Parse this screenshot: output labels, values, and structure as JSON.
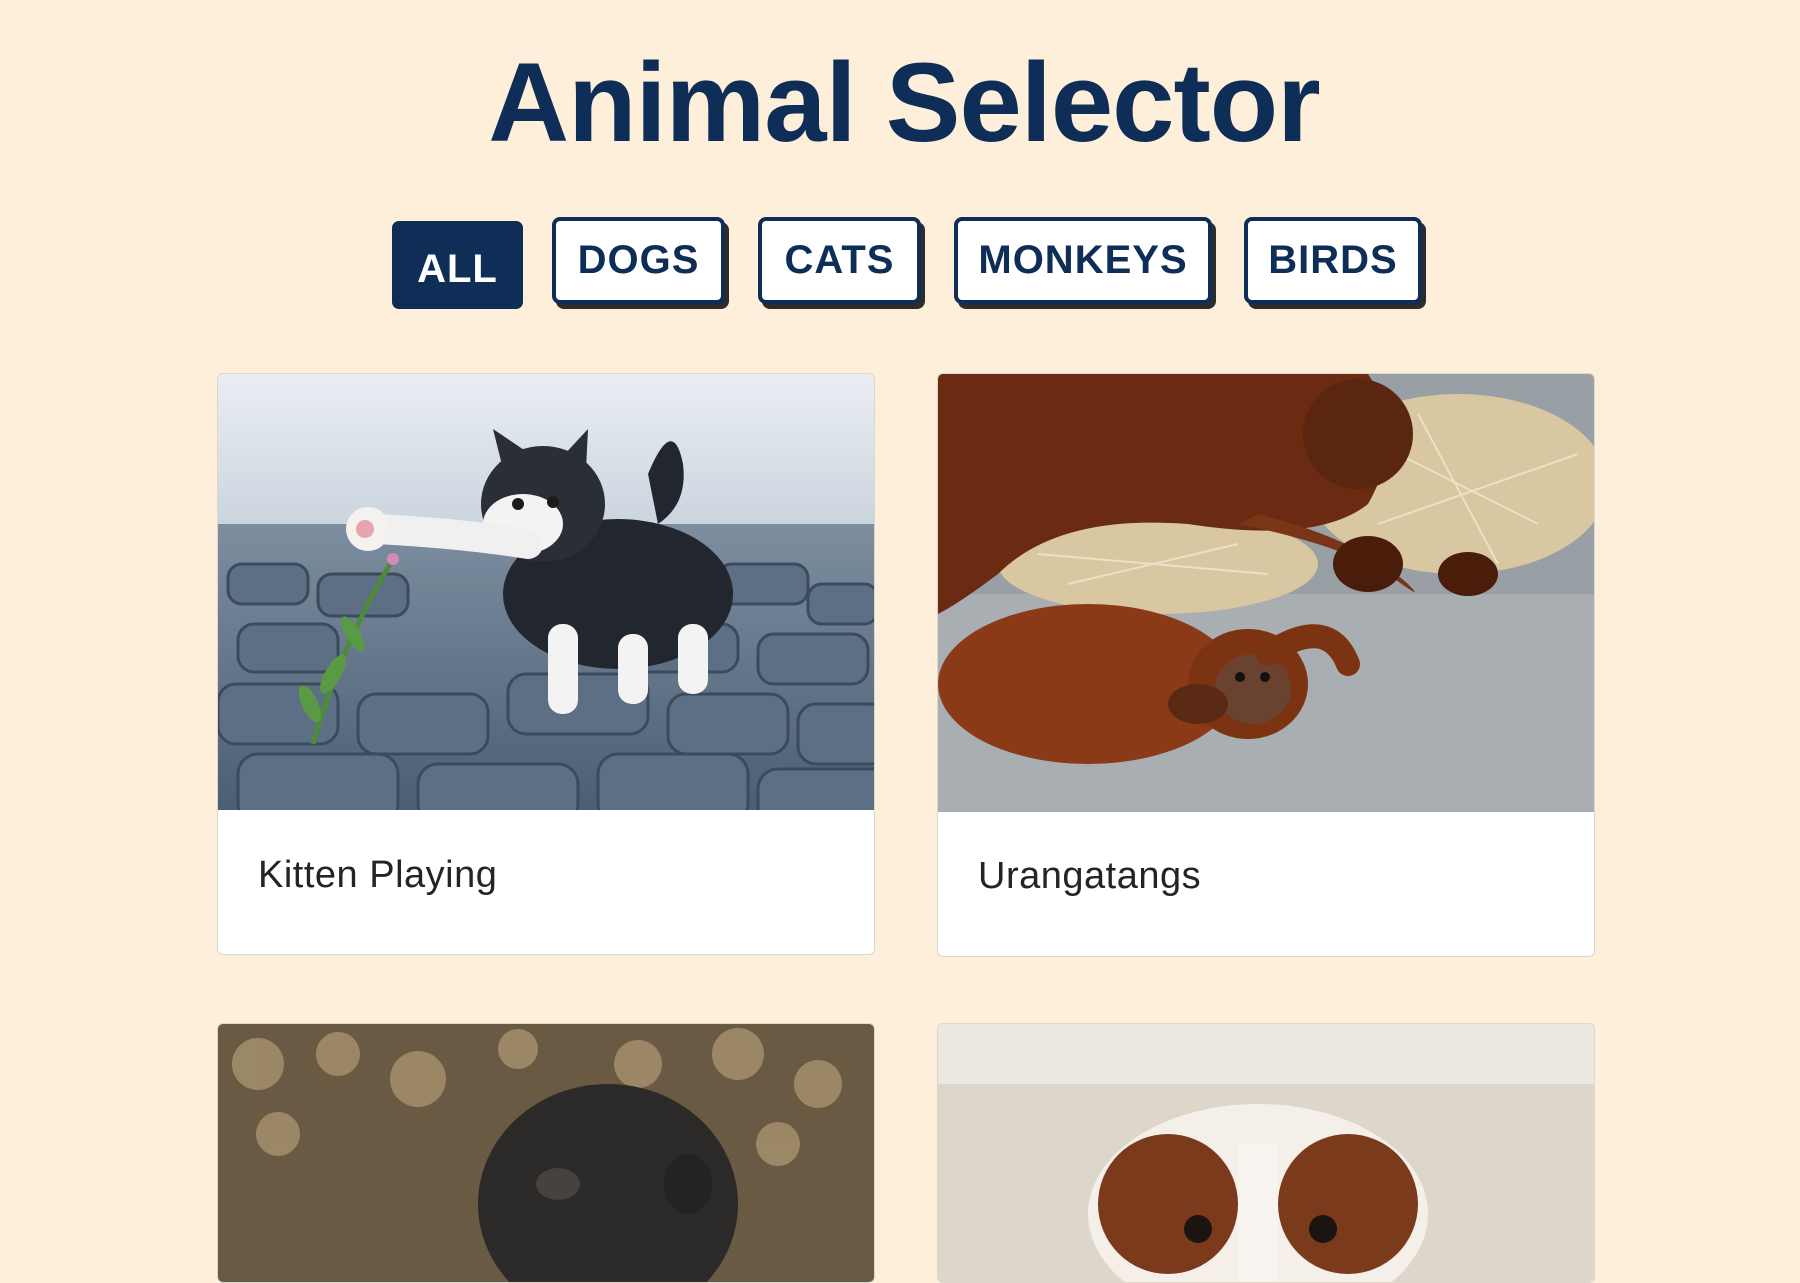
{
  "page": {
    "title": "Animal Selector"
  },
  "filters": [
    {
      "label": "ALL",
      "active": true
    },
    {
      "label": "DOGS",
      "active": false
    },
    {
      "label": "CATS",
      "active": false
    },
    {
      "label": "MONKEYS",
      "active": false
    },
    {
      "label": "BIRDS",
      "active": false
    }
  ],
  "cards": [
    {
      "title": "Kitten Playing",
      "image": "kitten-photo"
    },
    {
      "title": "Urangatangs",
      "image": "orangutan-photo"
    },
    {
      "title": "",
      "image": "gorilla-photo"
    },
    {
      "title": "",
      "image": "spaniel-dog-photo"
    }
  ],
  "colors": {
    "background": "#fdefd9",
    "accent": "#0e2d57",
    "card": "#ffffff"
  }
}
